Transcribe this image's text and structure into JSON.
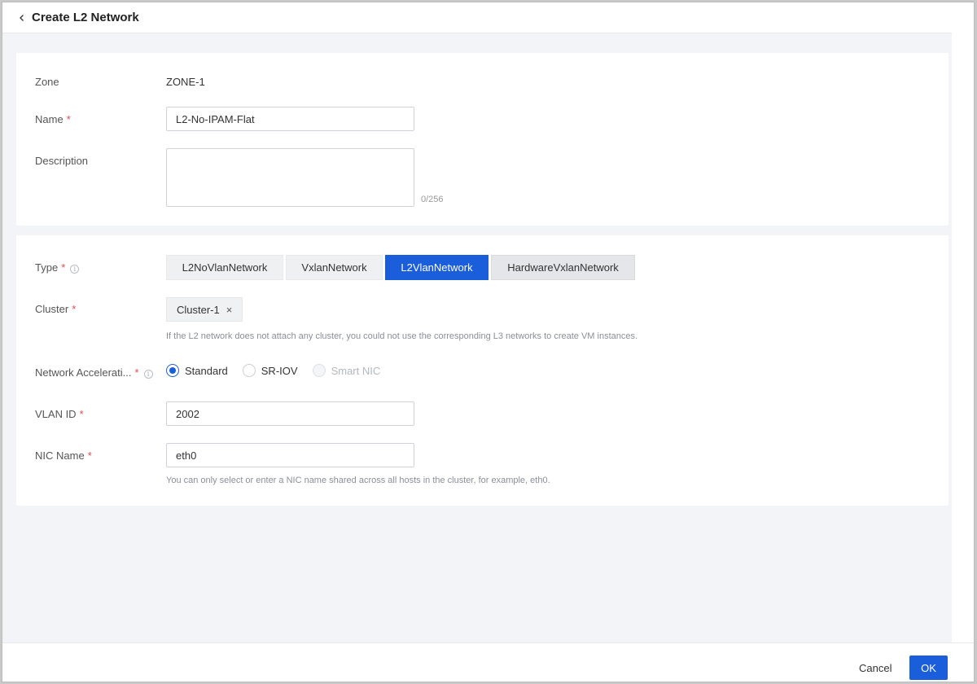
{
  "header": {
    "title": "Create L2 Network"
  },
  "basic": {
    "zone_label": "Zone",
    "zone_value": "ZONE-1",
    "name_label": "Name",
    "name_value": "L2-No-IPAM-Flat",
    "description_label": "Description",
    "description_value": "",
    "description_counter": "0/256"
  },
  "required_mark": "*",
  "info_glyph": "i",
  "network": {
    "type_label": "Type",
    "types": [
      {
        "label": "L2NoVlanNetwork",
        "active": false
      },
      {
        "label": "VxlanNetwork",
        "active": false
      },
      {
        "label": "L2VlanNetwork",
        "active": true
      },
      {
        "label": "HardwareVxlanNetwork",
        "active": false
      }
    ],
    "cluster_label": "Cluster",
    "cluster_tag": "Cluster-1",
    "cluster_tag_close": "×",
    "cluster_hint": "If the L2 network does not attach any cluster, you could not use the corresponding L3 networks to create VM instances.",
    "accel_label": "Network Accelerati...",
    "accel_options": [
      {
        "label": "Standard",
        "checked": true,
        "disabled": false
      },
      {
        "label": "SR-IOV",
        "checked": false,
        "disabled": false
      },
      {
        "label": "Smart NIC",
        "checked": false,
        "disabled": true
      }
    ],
    "vlan_label": "VLAN ID",
    "vlan_value": "2002",
    "nic_label": "NIC Name",
    "nic_value": "eth0",
    "nic_hint": "You can only select or enter a NIC name shared across all hosts in the cluster, for example, eth0."
  },
  "footer": {
    "cancel_label": "Cancel",
    "ok_label": "OK"
  },
  "colors": {
    "primary": "#1a5edb",
    "required": "#e5484d",
    "background": "#f3f4f7"
  }
}
